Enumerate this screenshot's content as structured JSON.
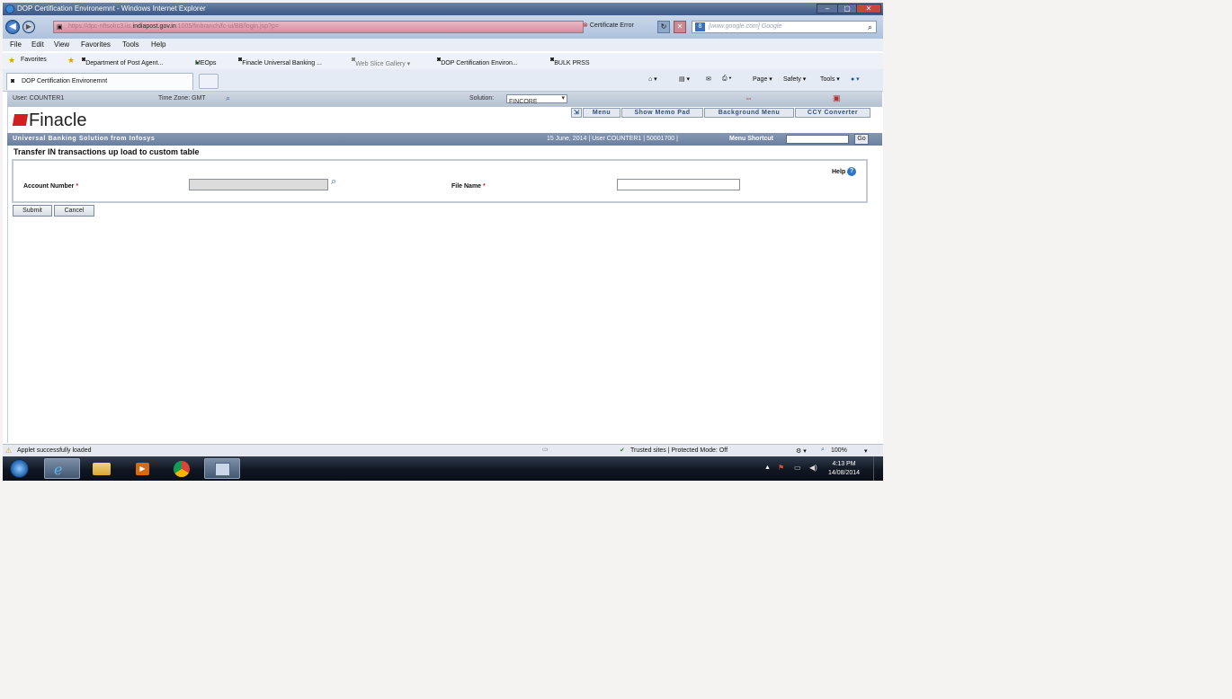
{
  "window": {
    "title": "DOP Certification Environemnt - Windows Internet Explorer",
    "controls": [
      "–",
      "▢",
      "✕"
    ]
  },
  "address_bar": {
    "url_prefix": "https://dpc-nftsolrc3.iis.",
    "url_host": "indiapost.gov.in",
    "url_suffix": ":1005/finbranch/fc-ui/BB/login.jsp?p=",
    "cert_error": "Certificate Error",
    "search_placeholder": "[www.google.com] Google"
  },
  "menu": [
    "File",
    "Edit",
    "View",
    "Favorites",
    "Tools",
    "Help"
  ],
  "favorites": {
    "label": "Favorites",
    "items": [
      "Department of Post Agent...",
      "MEOps",
      "Finacle Universal Banking ...",
      "Web Slice Gallery ▾",
      "DOP Certification Environ...",
      "BULK PRSS"
    ]
  },
  "tab": {
    "label": "DOP Certification Environemnt"
  },
  "command_bar": [
    "Page ▾",
    "Safety ▾",
    "Tools ▾"
  ],
  "finacle_top": {
    "user": "User: COUNTER1",
    "timezone": "Time Zone: GMT",
    "solution_label": "Solution:",
    "solution_value": "FINCORE"
  },
  "brand": {
    "name": "Finacle",
    "tagline": "Universal Banking Solution from Infosys"
  },
  "top_nav": [
    "Menu",
    "Show Memo Pad",
    "Background Menu",
    "CCY Converter"
  ],
  "info_bar": {
    "date_user": "15 June, 2014 | User COUNTER1 | 50001700 |",
    "menu_shortcut_label": "Menu Shortcut",
    "go_label": "Go"
  },
  "form": {
    "title": "Transfer IN transactions up load to custom table",
    "help": "Help",
    "account_label": "Account Number",
    "file_label": "File Name",
    "required_mark": "*",
    "submit": "Submit",
    "cancel": "Cancel"
  },
  "status_bar": {
    "left": "Applet successfully loaded",
    "zone": "Trusted sites | Protected Mode: Off",
    "zoom": "100%"
  },
  "taskbar": {
    "time": "4:13 PM",
    "date": "14/08/2014"
  }
}
